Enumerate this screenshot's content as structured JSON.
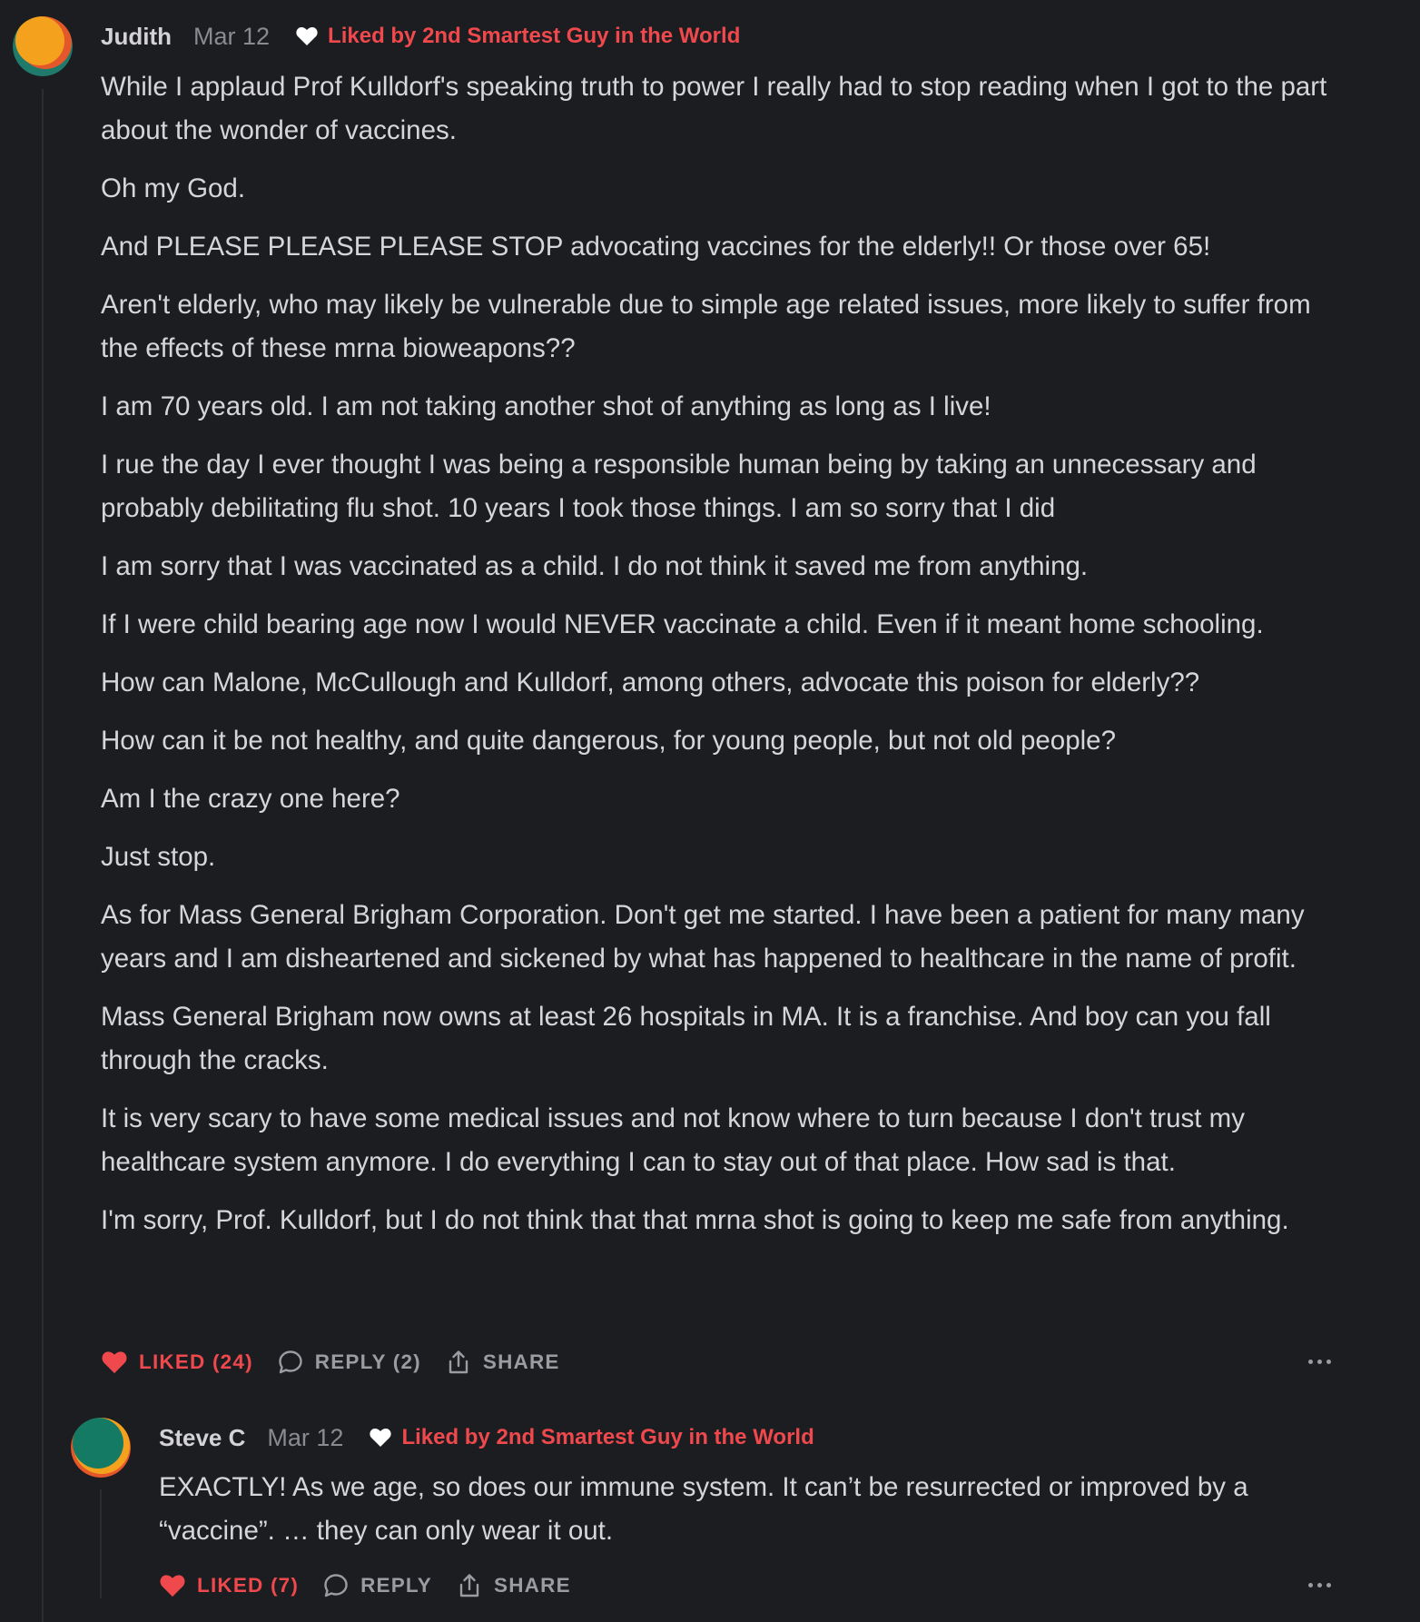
{
  "comments": [
    {
      "author": "Judith",
      "date": "Mar 12",
      "liked_by": "Liked by 2nd Smartest Guy in the World",
      "paragraphs": [
        "While I applaud Prof Kulldorf's speaking truth to power I really had to stop reading when I got to the part about the wonder of vaccines.",
        "Oh my God.",
        "And PLEASE PLEASE PLEASE STOP advocating vaccines for the elderly!! Or those over 65!",
        "Aren't elderly, who may likely be vulnerable due to simple age related issues, more likely to suffer from the effects of these mrna bioweapons??",
        "I am 70 years old. I am not taking another shot of anything as long as I live!",
        "I rue the day I ever thought I was being a responsible human being by taking an unnecessary and probably debilitating flu shot. 10 years I took those things. I am so sorry that I did",
        "I am sorry that I was vaccinated as a child. I do not think it saved me from anything.",
        "If I were child bearing age now I would NEVER vaccinate a child. Even if it meant home schooling.",
        "How can Malone, McCullough and Kulldorf, among others, advocate this poison for elderly??",
        "How can it be not healthy, and quite dangerous, for young people, but not old people?",
        "Am I the crazy one here?",
        "Just stop.",
        "As for Mass General Brigham Corporation. Don't get me started. I have been a patient for many many years and I am disheartened and sickened by what has happened to healthcare in the name of profit.",
        "Mass General Brigham now owns at least 26 hospitals in MA. It is a franchise. And boy can you fall through the cracks.",
        "It is very scary to have some medical issues and not know where to turn because I don't trust my healthcare system anymore. I do everything I can to stay out of that place. How sad is that.",
        "I'm sorry, Prof. Kulldorf, but I do not think that that mrna shot is going to keep me safe from anything."
      ],
      "actions": {
        "like": "LIKED (24)",
        "reply": "REPLY (2)",
        "share": "SHARE"
      },
      "avatar_colors": [
        "#f4a21e",
        "#1f7a6b",
        "#e3572b"
      ]
    },
    {
      "author": "Steve C",
      "date": "Mar 12",
      "liked_by": "Liked by 2nd Smartest Guy in the World",
      "paragraphs": [
        "EXACTLY! As we age, so does our immune system. It can’t be resurrected or improved by a “vaccine”. … they can only wear it out."
      ],
      "actions": {
        "like": "LIKED (7)",
        "reply": "REPLY",
        "share": "SHARE"
      },
      "avatar_colors": [
        "#157a63",
        "#f4a21e",
        "#e3572b"
      ]
    }
  ],
  "colors": {
    "background": "#1c1d21",
    "accent_red": "#f0494d",
    "muted": "#9b9ca1"
  },
  "icons": [
    "heart-icon",
    "comment-bubble-icon",
    "share-icon",
    "more-dots-icon"
  ]
}
